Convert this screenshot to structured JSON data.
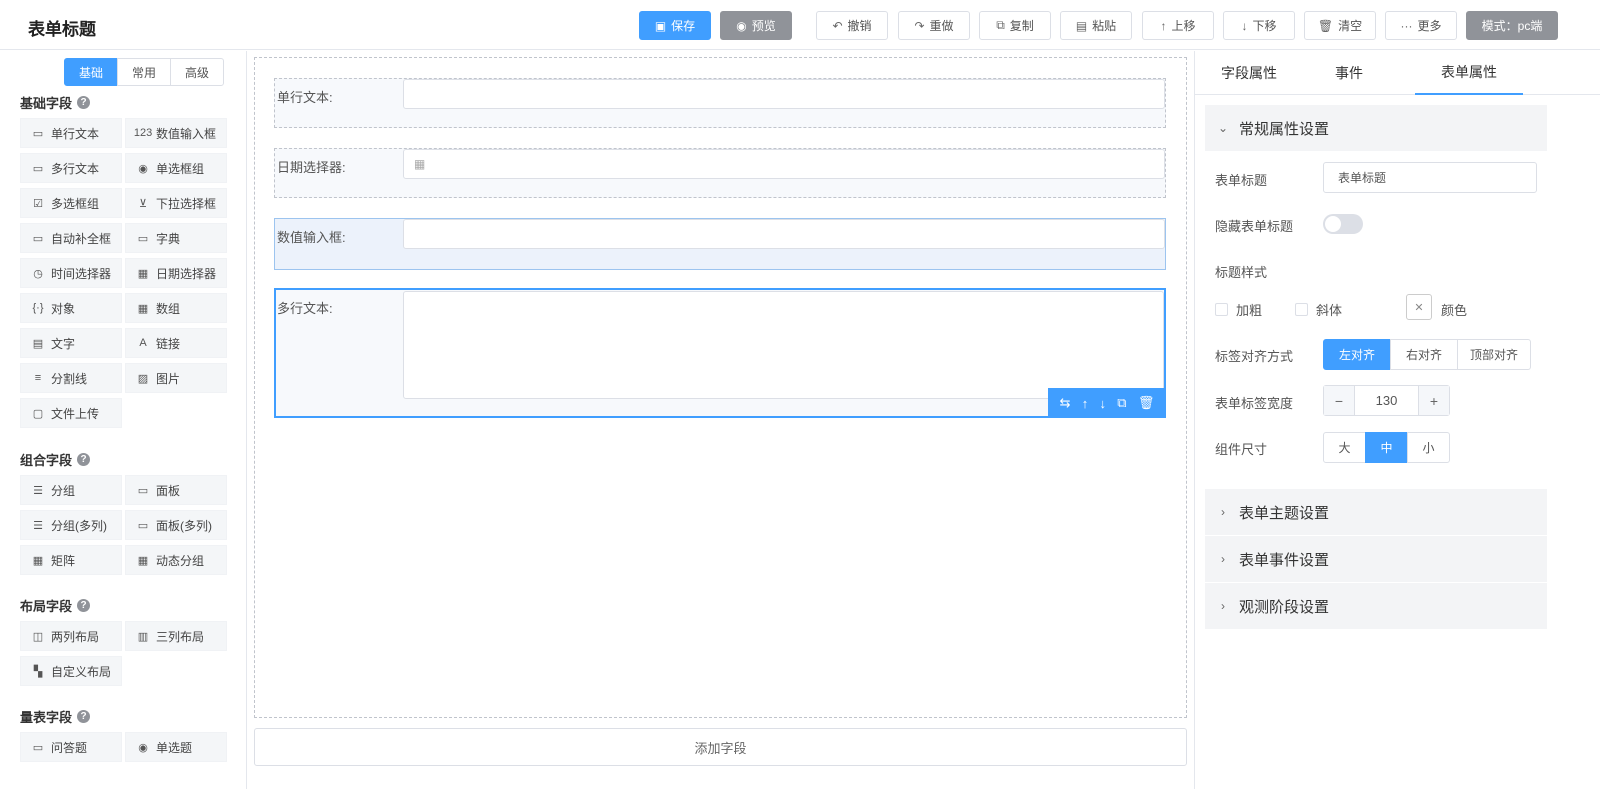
{
  "header": {
    "title": "表单标题",
    "buttons": [
      {
        "label": "保存",
        "icon": "save-icon",
        "glyph": "🖫"
      },
      {
        "label": "预览",
        "icon": "eye-icon",
        "glyph": "◉"
      },
      {
        "label": "撤销",
        "icon": "undo-icon",
        "glyph": "↶"
      },
      {
        "label": "重做",
        "icon": "redo-icon",
        "glyph": "↷"
      },
      {
        "label": "复制",
        "icon": "copy-icon",
        "glyph": "⧉"
      },
      {
        "label": "粘贴",
        "icon": "paste-icon",
        "glyph": "🗎"
      },
      {
        "label": "上移",
        "icon": "arrow-up-icon",
        "glyph": "↑"
      },
      {
        "label": "下移",
        "icon": "arrow-down-icon",
        "glyph": "↓"
      },
      {
        "label": "清空",
        "icon": "trash-icon",
        "glyph": "🗑"
      },
      {
        "label": "更多",
        "icon": "more-icon",
        "glyph": "···"
      }
    ],
    "mode_label": "模式：pc端"
  },
  "left": {
    "tabs": [
      "基础",
      "常用",
      "高级"
    ],
    "active_tab": "基础",
    "groups": {
      "basic": {
        "title": "基础字段",
        "items": [
          {
            "label": "单行文本",
            "icon": "input-icon",
            "glyph": "▭"
          },
          {
            "label": "数值输入框",
            "icon": "number-icon",
            "glyph": "123"
          },
          {
            "label": "多行文本",
            "icon": "textarea-icon",
            "glyph": "▭"
          },
          {
            "label": "单选框组",
            "icon": "radio-icon",
            "glyph": "◉"
          },
          {
            "label": "多选框组",
            "icon": "checkbox-icon",
            "glyph": "☑"
          },
          {
            "label": "下拉选择框",
            "icon": "select-icon",
            "glyph": "⊻"
          },
          {
            "label": "自动补全框",
            "icon": "autocomplete-icon",
            "glyph": "▭"
          },
          {
            "label": "字典",
            "icon": "dict-icon",
            "glyph": "▭"
          },
          {
            "label": "时间选择器",
            "icon": "clock-icon",
            "glyph": "◷"
          },
          {
            "label": "日期选择器",
            "icon": "calendar-icon",
            "glyph": "▦"
          },
          {
            "label": "对象",
            "icon": "object-icon",
            "glyph": "{·}"
          },
          {
            "label": "数组",
            "icon": "array-icon",
            "glyph": "▦"
          },
          {
            "label": "文字",
            "icon": "text-icon",
            "glyph": "▤"
          },
          {
            "label": "链接",
            "icon": "link-icon",
            "glyph": "A"
          },
          {
            "label": "分割线",
            "icon": "divider-icon",
            "glyph": "≡"
          },
          {
            "label": "图片",
            "icon": "image-icon",
            "glyph": "▨"
          },
          {
            "label": "文件上传",
            "icon": "upload-icon",
            "glyph": "▢"
          }
        ]
      },
      "composite": {
        "title": "组合字段",
        "items": [
          {
            "label": "分组",
            "icon": "group-icon",
            "glyph": "☰"
          },
          {
            "label": "面板",
            "icon": "panel-icon",
            "glyph": "▭"
          },
          {
            "label": "分组(多列)",
            "icon": "group-multi-icon",
            "glyph": "☰"
          },
          {
            "label": "面板(多列)",
            "icon": "panel-multi-icon",
            "glyph": "▭"
          },
          {
            "label": "矩阵",
            "icon": "matrix-icon",
            "glyph": "▦"
          },
          {
            "label": "动态分组",
            "icon": "dynamic-group-icon",
            "glyph": "▦"
          }
        ]
      },
      "layout": {
        "title": "布局字段",
        "items": [
          {
            "label": "两列布局",
            "icon": "two-col-icon",
            "glyph": "◫"
          },
          {
            "label": "三列布局",
            "icon": "three-col-icon",
            "glyph": "▥"
          },
          {
            "label": "自定义布局",
            "icon": "custom-layout-icon",
            "glyph": "▚"
          }
        ]
      },
      "scale": {
        "title": "量表字段",
        "items": [
          {
            "label": "问答题",
            "icon": "qa-icon",
            "glyph": "▭"
          },
          {
            "label": "单选题",
            "icon": "single-choice-icon",
            "glyph": "◉"
          }
        ]
      }
    }
  },
  "canvas": {
    "rows": [
      {
        "label": "单行文本:"
      },
      {
        "label": "日期选择器:"
      },
      {
        "label": "数值输入框:"
      },
      {
        "label": "多行文本:"
      }
    ],
    "add_field": "添加字段"
  },
  "right": {
    "tabs": [
      "字段属性",
      "事件",
      "表单属性"
    ],
    "active_tab": "表单属性",
    "general_section": "常规属性设置",
    "props": {
      "form_title_label": "表单标题",
      "form_title_value": "表单标题",
      "hide_title_label": "隐藏表单标题",
      "hide_title_on": false,
      "title_style_label": "标题样式",
      "bold_label": "加粗",
      "italic_label": "斜体",
      "color_label": "颜色",
      "align_label": "标签对齐方式",
      "align_options": [
        "左对齐",
        "右对齐",
        "顶部对齐"
      ],
      "align_selected": "左对齐",
      "width_label": "表单标签宽度",
      "width_value": "130",
      "size_label": "组件尺寸",
      "size_options": [
        "大",
        "中",
        "小"
      ],
      "size_selected": "中"
    },
    "collapsed_sections": [
      "表单主题设置",
      "表单事件设置",
      "观测阶段设置"
    ]
  },
  "colors": {
    "primary": "#409eff",
    "gray_button": "#909399"
  }
}
